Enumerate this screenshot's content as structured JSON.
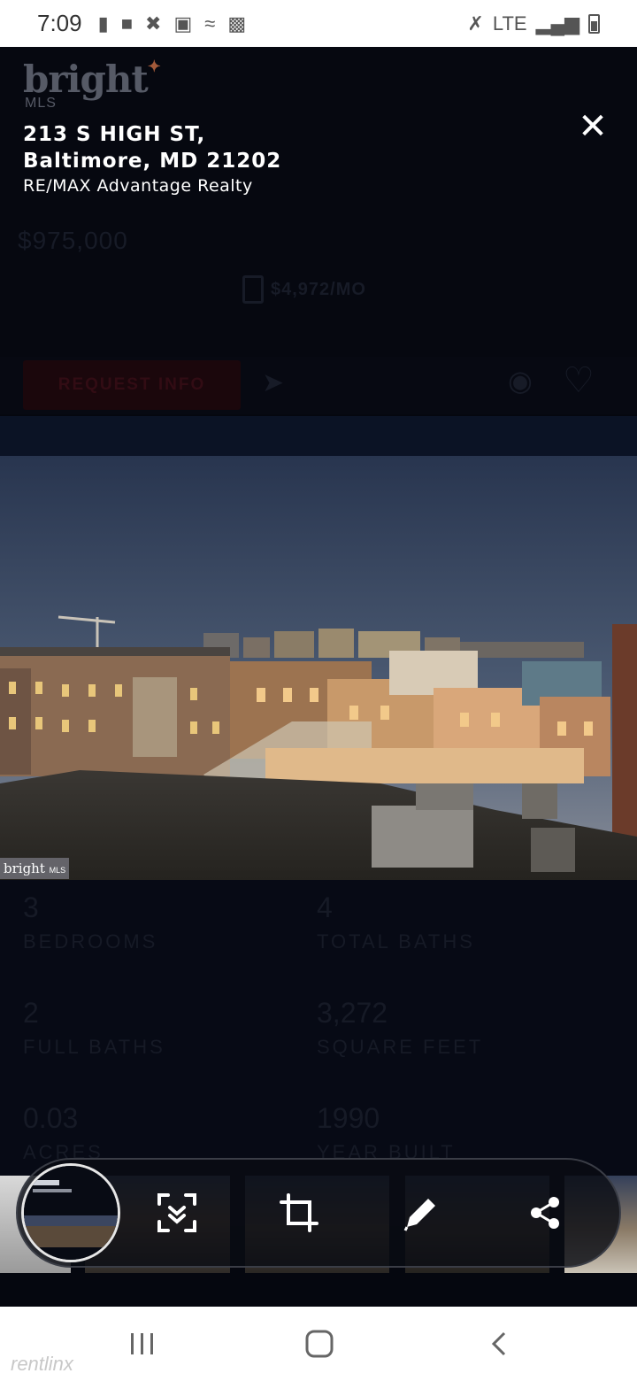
{
  "status_bar": {
    "time": "7:09",
    "network": "LTE",
    "left_icons": [
      "message-icon",
      "app-icon",
      "missed-call-icon",
      "image-icon",
      "wifi-calling-icon",
      "screenshot-icon"
    ],
    "right_icons": [
      "mute-icon",
      "signal-icon",
      "battery-icon"
    ]
  },
  "logo": {
    "text": "bright",
    "subtext": "MLS"
  },
  "listing": {
    "address_line1": "213 S HIGH ST,",
    "address_line2": "Baltimore, MD 21202",
    "brokerage": "RE/MAX Advantage Realty",
    "price": "$975,000",
    "monthly": "$4,972/MO",
    "request_label": "REQUEST INFO"
  },
  "photo": {
    "watermark": "bright",
    "watermark_sub": "MLS"
  },
  "facts": [
    {
      "value": "3",
      "label": "BEDROOMS"
    },
    {
      "value": "4",
      "label": "TOTAL BATHS"
    },
    {
      "value": "2",
      "label": "FULL BATHS"
    },
    {
      "value": "3,272",
      "label": "SQUARE FEET"
    },
    {
      "value": "0.03",
      "label": "ACRES"
    },
    {
      "value": "1990",
      "label": "YEAR BUILT"
    }
  ],
  "toolbar": {
    "tools": [
      "scroll-capture-icon",
      "crop-icon",
      "edit-icon",
      "share-icon"
    ]
  },
  "nav": {
    "watermark": "rentlinx"
  },
  "colors": {
    "accent_star": "#a35a3a",
    "overlay": "#05070f",
    "white": "#ffffff"
  }
}
